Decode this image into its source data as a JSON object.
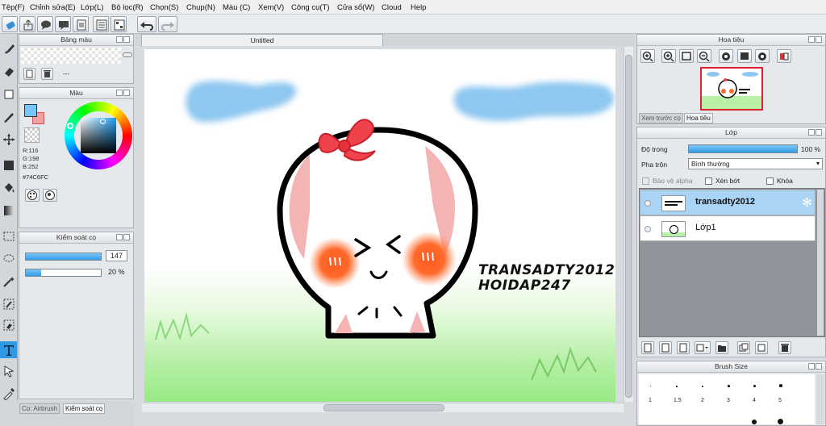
{
  "menu": [
    "Tệp(F)",
    "Chỉnh sửa(E)",
    "Lớp(L)",
    "Bộ lọc(R)",
    "Chọn(S)",
    "Chụp(N)",
    "Màu (C)",
    "Xem(V)",
    "Công cụ(T)",
    "Cửa sổ(W)",
    "Cloud",
    "Help"
  ],
  "palette_panel": {
    "title": "Bảng màu",
    "label": "---"
  },
  "color_panel": {
    "title": "Màu",
    "r": "R:116",
    "g": "G:198",
    "b": "B:252",
    "hex": "#74C6FC",
    "foreground": "#74C6FC",
    "background": "#F4A0A0"
  },
  "brush_control": {
    "title": "Kiểm soát cọ",
    "size": "147",
    "opacity": "20 %",
    "opacity_fraction": 0.2
  },
  "bottom_tabs": [
    "Cọ: Airbrush",
    "Kiểm soát cọ"
  ],
  "document": {
    "tab_title": "Untitled",
    "watermark_line1": "TRANSADTY2012",
    "watermark_line2": "HOIDAP247"
  },
  "navigator": {
    "title": "Hoa tiêu",
    "tabs": [
      "Xem trước cọ",
      "Hoa tiêu"
    ]
  },
  "layers_panel": {
    "title": "Lớp",
    "opacity_label": "Độ trong",
    "opacity_value": "100 %",
    "opacity_fraction": 1.0,
    "blend_label": "Pha trộn",
    "blend_value": "Bình thường",
    "protect_alpha": "Bảo vệ alpha",
    "clipping": "Xén bớt",
    "lock": "Khóa",
    "layers": [
      {
        "name": "transadty2012",
        "selected": true
      },
      {
        "name": "Lớp1",
        "selected": false
      }
    ]
  },
  "brush_size": {
    "title": "Brush Size",
    "sizes": [
      "1",
      "1.5",
      "2",
      "3",
      "4",
      "5"
    ]
  },
  "colors": {
    "accent": "#2F9AE3",
    "selected_layer": "#A9D4F5"
  }
}
